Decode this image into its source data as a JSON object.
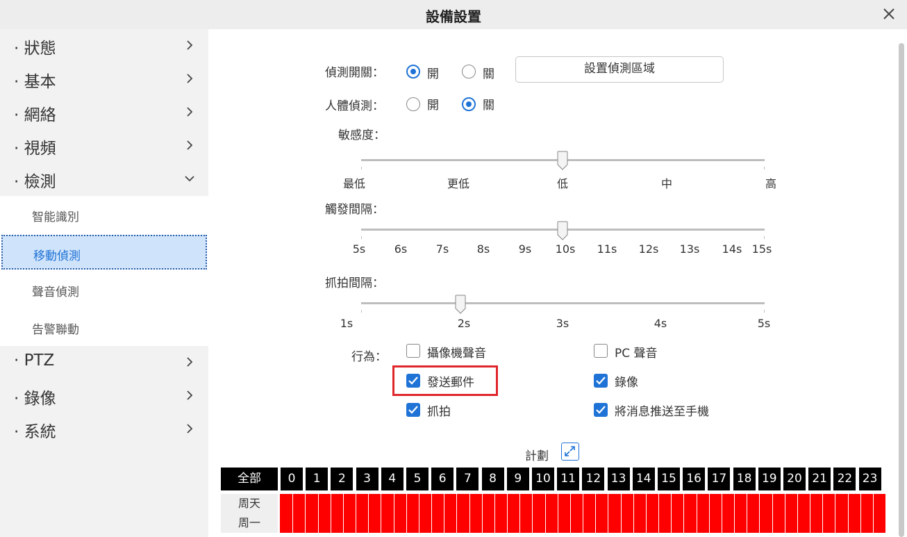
{
  "window": {
    "title": "設備設置"
  },
  "sidebar": {
    "items": [
      {
        "label": "· 狀態"
      },
      {
        "label": "· 基本"
      },
      {
        "label": "· 網絡"
      },
      {
        "label": "· 視頻"
      },
      {
        "label": "· 檢測"
      }
    ],
    "sub_items": [
      {
        "label": "智能識別"
      },
      {
        "label": "移動偵測"
      },
      {
        "label": "聲音偵測"
      },
      {
        "label": "告警聯動"
      }
    ],
    "items_after": [
      {
        "label": "· PTZ"
      },
      {
        "label": "· 錄像"
      },
      {
        "label": "· 系統"
      }
    ],
    "active_sub": "移動偵測"
  },
  "detection": {
    "switch_label": "偵測開關：",
    "switch_on": "開",
    "switch_off": "關",
    "switch_value": "開",
    "area_button": "設置偵測區域",
    "human_label": "人體偵測：",
    "human_on": "開",
    "human_off": "關",
    "human_value": "關"
  },
  "sensitivity": {
    "label": "敏感度：",
    "ticks": [
      "最低",
      "更低",
      "低",
      "中",
      "高"
    ],
    "value": "低"
  },
  "trigger_interval": {
    "label": "觸發間隔：",
    "ticks": [
      "5s",
      "6s",
      "7s",
      "8s",
      "9s",
      "10s",
      "11s",
      "12s",
      "13s",
      "14s",
      "15s"
    ],
    "value": "10s"
  },
  "snapshot_interval": {
    "label": "抓拍間隔：",
    "ticks": [
      "1s",
      "2s",
      "3s",
      "4s",
      "5s"
    ],
    "value": "2s"
  },
  "actions": {
    "label": "行為：",
    "camera_sound": {
      "label": "攝像機聲音",
      "checked": false
    },
    "pc_sound": {
      "label": "PC 聲音",
      "checked": false
    },
    "send_email": {
      "label": "發送郵件",
      "checked": true
    },
    "record": {
      "label": "錄像",
      "checked": true
    },
    "snapshot": {
      "label": "抓拍",
      "checked": true
    },
    "push": {
      "label": "將消息推送至手機",
      "checked": true
    }
  },
  "schedule": {
    "label": "計劃",
    "all_label": "全部",
    "hours": [
      "0",
      "1",
      "2",
      "3",
      "4",
      "5",
      "6",
      "7",
      "8",
      "9",
      "10",
      "11",
      "12",
      "13",
      "14",
      "15",
      "16",
      "17",
      "18",
      "19",
      "20",
      "21",
      "22",
      "23"
    ],
    "days": [
      "周天",
      "周一"
    ],
    "active_color": "#ff0000"
  },
  "colors": {
    "accent": "#1f73d6",
    "highlight": "#e0262a"
  }
}
